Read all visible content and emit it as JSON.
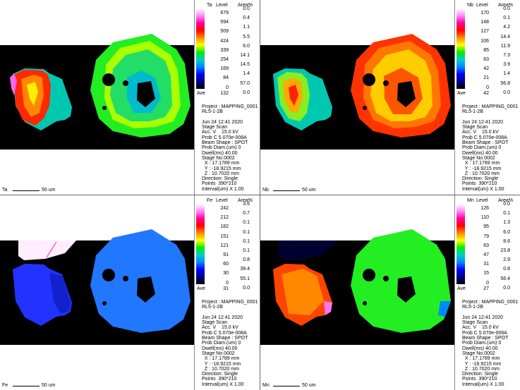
{
  "header_labels": {
    "level": "Level",
    "area": "Area%"
  },
  "ave_label": "Ave",
  "scale_label": "50 um",
  "panels": [
    {
      "element": "Ta",
      "levels": [
        "679",
        "594",
        "509",
        "424",
        "339",
        "254",
        "169",
        "84",
        "0"
      ],
      "areas": [
        "0.0",
        "0.4",
        "1.1",
        "5.5",
        "6.0",
        "14.1",
        "14.5",
        "1.4",
        "57.0",
        "0.0"
      ],
      "ave": "132",
      "info": [
        "Project : MAPPING_0001",
        "RL5-1-2B",
        "",
        "Jun 24 12:41 2020",
        "Stage Scan",
        "Acc. V    15.0 kV",
        "Prob C 5.070e-008A",
        "Beam Shape : SPOT",
        "Prob Diam.(um) 0",
        "Dwell(ms) 40.00",
        "Stage No.0002",
        "  X : 17.1789 mm",
        "  Y : -18.9215 mm",
        "  Z : 10.7020 mm",
        "Direction: Single",
        "Points  390*210",
        "Interval(um) X 1.00"
      ]
    },
    {
      "element": "Nb",
      "levels": [
        "170",
        "148",
        "127",
        "106",
        "85",
        "63",
        "42",
        "21",
        "0"
      ],
      "areas": [
        "0.0",
        "0.1",
        "4.2",
        "14.4",
        "11.9",
        "7.3",
        "3.9",
        "1.4",
        "56.8",
        "0.0"
      ],
      "ave": "42",
      "info": [
        "Project : MAPPING_0001",
        "RL5-1-2B",
        "",
        "Jun 24 12:41 2020",
        "Stage Scan",
        "Acc. V    15.0 kV",
        "Prob C 5.070e-008A",
        "Beam Shape : SPOT",
        "Prob Diam.(um) 0",
        "Dwell(ms) 40.00",
        "Stage No.0002",
        "  X : 17.1789 mm",
        "  Y : -18.9215 mm",
        "  Z : 10.7020 mm",
        "Direction: Single",
        "Points  390*210",
        "Interval(um) X 1.00"
      ]
    },
    {
      "element": "Fe",
      "levels": [
        "242",
        "212",
        "182",
        "151",
        "121",
        "91",
        "60",
        "30",
        "0"
      ],
      "areas": [
        "3.6",
        "0.7",
        "0.1",
        "0.1",
        "0.1",
        "0.1",
        "0.8",
        "39.4",
        "55.1",
        "0.0"
      ],
      "ave": "31",
      "info": [
        "Project : MAPPING_0001",
        "RL5-1-2B",
        "",
        "Jun 24 12:41 2020",
        "Stage Scan",
        "Acc. V    15.0 kV",
        "Prob C 5.070e-008A",
        "Beam Shape : SPOT",
        "Prob Diam.(um) 0",
        "Dwell(ms) 40.00",
        "Stage No.0002",
        "  X : 17.1789 mm",
        "  Y : -18.9215 mm",
        "  Z : 10.7020 mm",
        "Direction: Single",
        "Points  390*210",
        "Interval(um) X 1.00"
      ]
    },
    {
      "element": "Mn",
      "levels": [
        "126",
        "110",
        "95",
        "79",
        "63",
        "47",
        "31",
        "15",
        "0"
      ],
      "areas": [
        "0.0",
        "0.1",
        "1.3",
        "6.0",
        "8.6",
        "23.8",
        "2.9",
        "0.8",
        "56.4",
        "0.0"
      ],
      "ave": "27",
      "info": [
        "Project : MAPPING_0001",
        "RL5-1-2B",
        "",
        "Jun 24 12:41 2020",
        "Stage Scan",
        "Acc. V    15.0 kV",
        "Prob C 5.070e-008A",
        "Beam Shape : SPOT",
        "Prob Diam.(um) 0",
        "Dwell(ms) 40.00",
        "Stage No.0002",
        "  X : 17.1789 mm",
        "  Y : -18.9215 mm",
        "  Z : 10.7020 mm",
        "Direction: Single",
        "Points  390*210",
        "Interval(um) X 1.00"
      ]
    }
  ],
  "colors": {
    "background_map": "#000000",
    "colorbar": [
      "#ffffff",
      "#ff88ff",
      "#ff0099",
      "#ff0000",
      "#ff8800",
      "#ffff00",
      "#00ee00",
      "#00cccc",
      "#0088ff",
      "#0000ff",
      "#000088",
      "#000000"
    ]
  }
}
